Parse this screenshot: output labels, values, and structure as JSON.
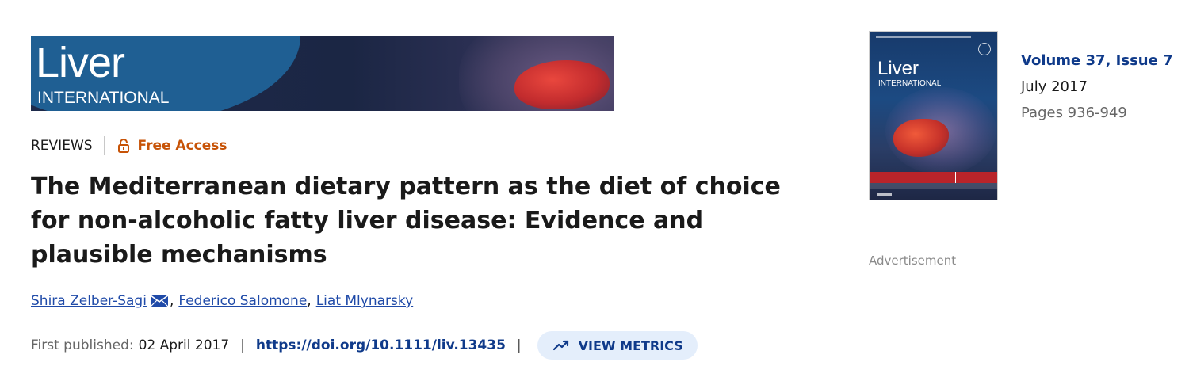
{
  "banner": {
    "logo_main": "Liver",
    "logo_sub": "INTERNATIONAL"
  },
  "article": {
    "category": "REVIEWS",
    "access_label": "Free Access",
    "title": "The Mediterranean dietary pattern as the diet of choice for non-alcoholic fatty liver disease: Evidence and plausible mechanisms",
    "authors": [
      {
        "name": "Shira Zelber-Sagi",
        "corresponding": true
      },
      {
        "name": "Federico Salomone",
        "corresponding": false
      },
      {
        "name": "Liat Mlynarsky",
        "corresponding": false
      }
    ],
    "first_published_label": "First published:",
    "first_published_date": "02 April 2017",
    "doi": "https://doi.org/10.1111/liv.13435",
    "metrics_button": "VIEW METRICS"
  },
  "sidebar": {
    "cover_logo_main": "Liver",
    "cover_logo_sub": "INTERNATIONAL",
    "volume": "Volume 37, Issue 7",
    "issue_date": "July 2017",
    "pages": "Pages 936-949",
    "advertisement_label": "Advertisement"
  },
  "icons": {
    "lock": "lock-open-icon",
    "mail": "envelope-icon",
    "metrics": "trending-up-icon"
  },
  "colors": {
    "access": "#c75307",
    "link": "#1f4aa8",
    "doi": "#0f3a8a",
    "metrics_bg": "#e4eefb"
  }
}
